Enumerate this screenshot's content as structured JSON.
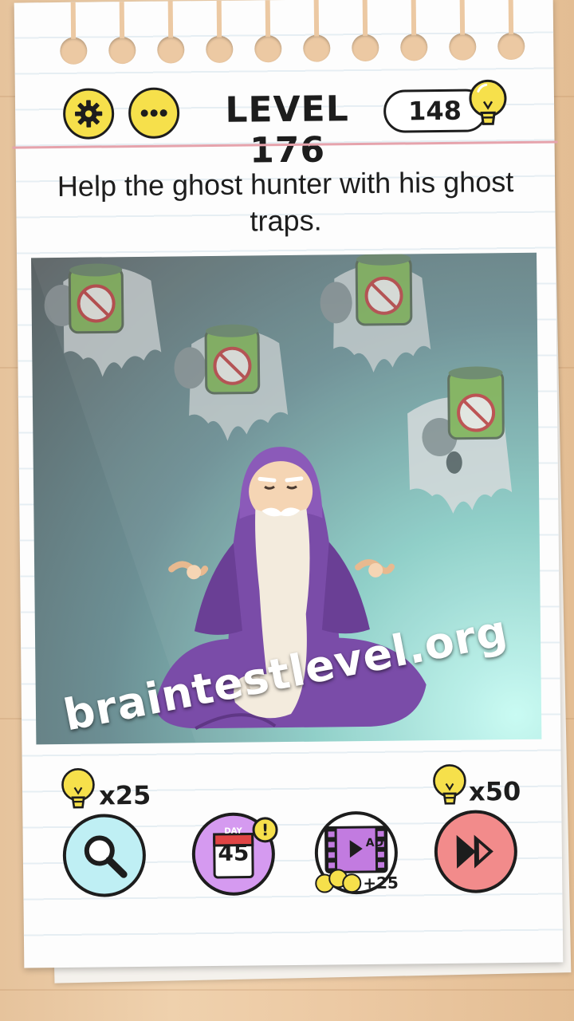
{
  "header": {
    "level_label": "LEVEL 176",
    "coins": "148"
  },
  "question": {
    "text": "Help the ghost hunter with his ghost traps."
  },
  "watermark": {
    "text": "braintestlevel.org"
  },
  "powerups": {
    "hint_cost": "x25",
    "skip_cost": "x50",
    "daily": {
      "day_label": "DAY",
      "day_number": "45",
      "badge": "!"
    },
    "ad": {
      "label": "AD",
      "reward": "+25"
    }
  },
  "icons": {
    "settings": "gear-icon",
    "more": "ellipsis-icon",
    "coin": "lightbulb-icon",
    "hint": "magnifier-icon",
    "daily": "calendar-icon",
    "ad": "film-play-icon",
    "skip": "fast-forward-icon"
  },
  "colors": {
    "yellow": "#f6e04b",
    "hint_bg": "#bfeff4",
    "daily_bg": "#d59af0",
    "skip_bg": "#f28b8b",
    "purple": "#7a4ca8"
  }
}
